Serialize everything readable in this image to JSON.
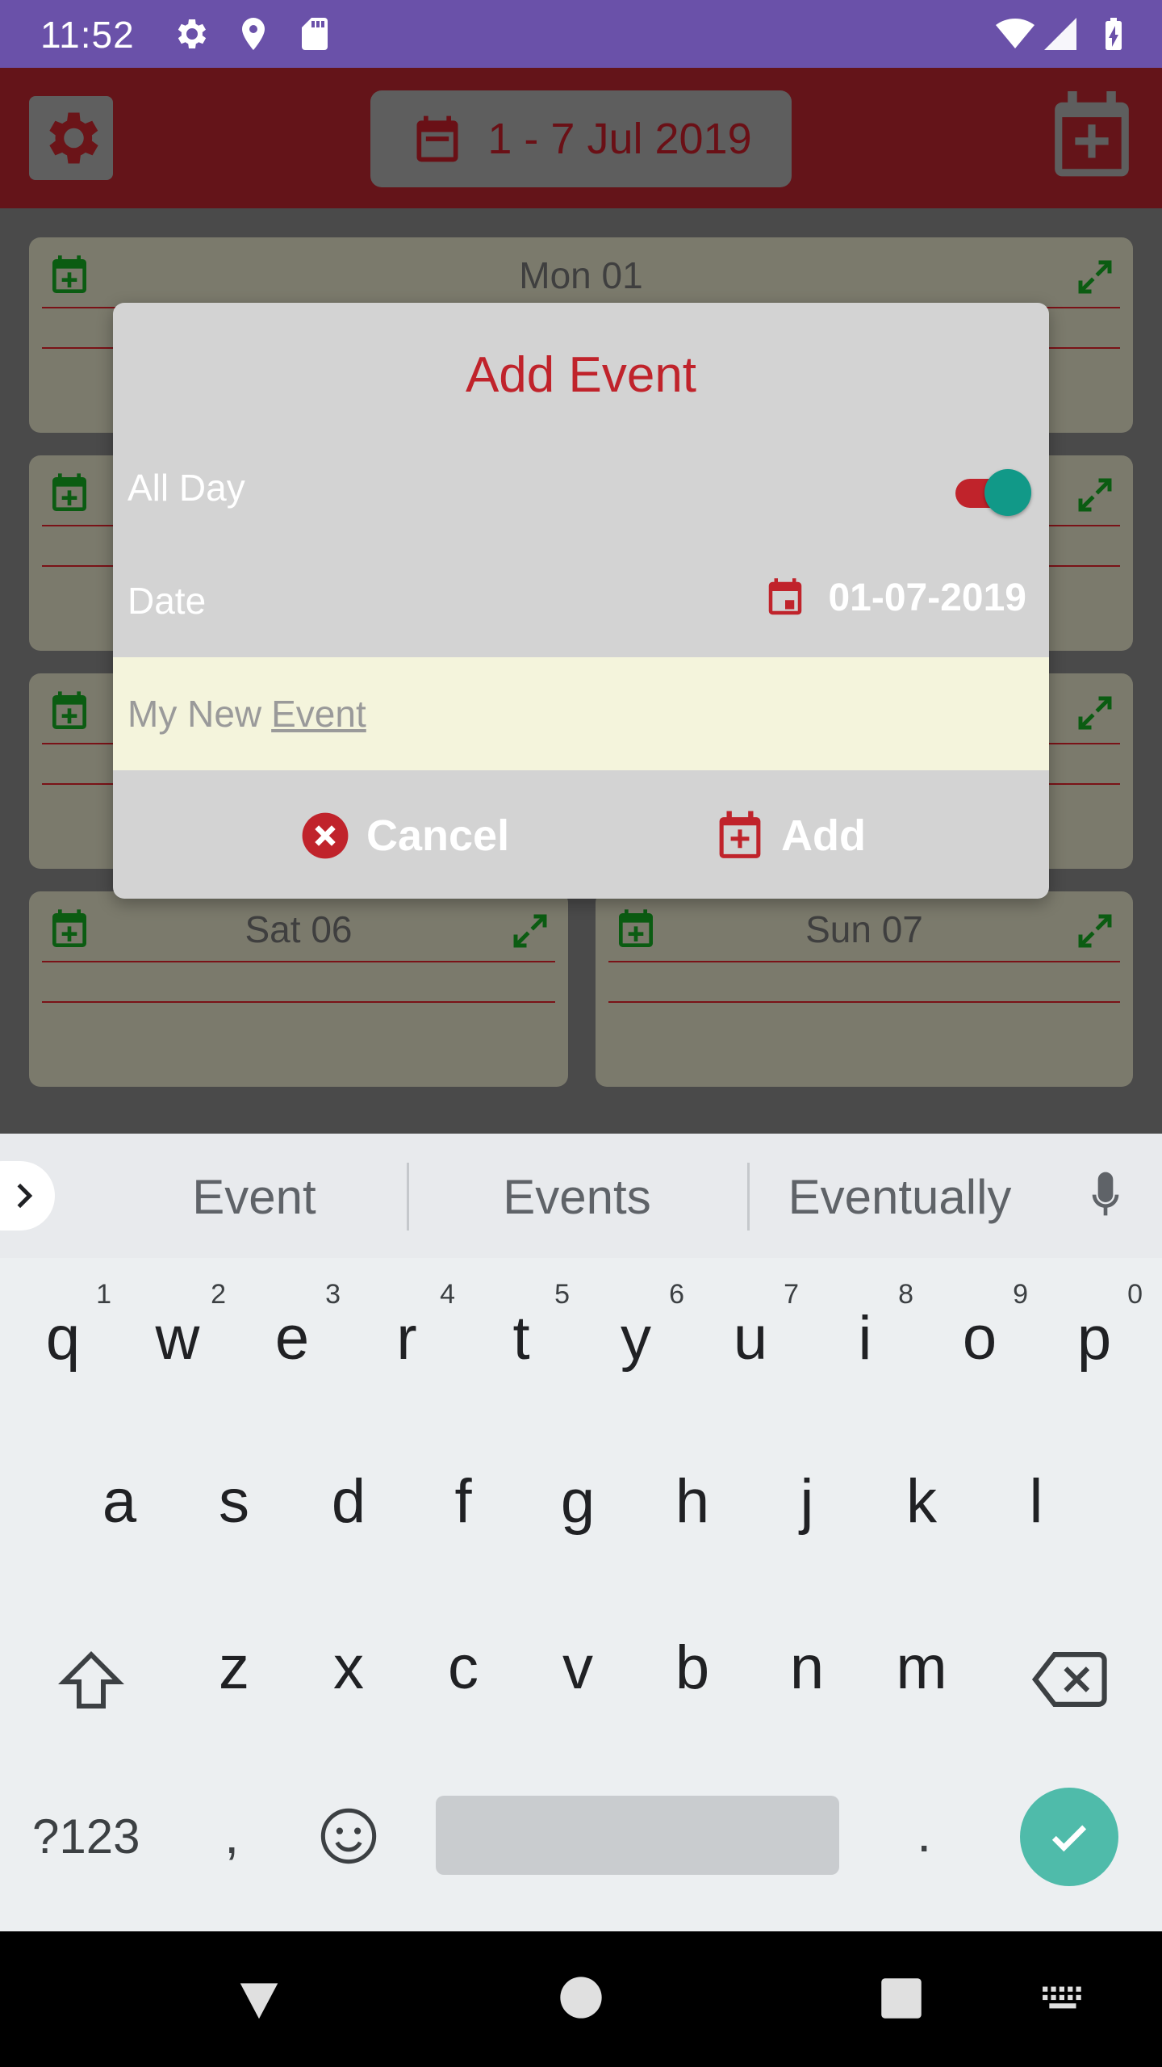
{
  "status_bar": {
    "time": "11:52",
    "icons": [
      "gear-icon",
      "location-icon",
      "sd-card-icon",
      "wifi-icon",
      "signal-icon",
      "battery-charging-icon"
    ],
    "background": "#6a51a9"
  },
  "app_bar": {
    "week_label": "1 - 7 Jul 2019",
    "background": "#641419"
  },
  "days": [
    {
      "label": "Mon 01"
    },
    {
      "label": ""
    },
    {
      "label": ""
    },
    {
      "label": ""
    },
    {
      "label": ""
    },
    {
      "label": ""
    },
    {
      "label": "Sat 06"
    },
    {
      "label": "Sun 07"
    }
  ],
  "dialog": {
    "title": "Add Event",
    "all_day_label": "All Day",
    "all_day_on": true,
    "date_label": "Date",
    "date_value": "01-07-2019",
    "name_value_prefix": "My New",
    "name_value_word": "Event",
    "cancel_label": "Cancel",
    "add_label": "Add",
    "accent": "#c0232b",
    "toggle_thumb": "#119988"
  },
  "keyboard": {
    "suggestions": [
      "Event",
      "Events",
      "Eventually"
    ],
    "row1": [
      {
        "k": "q",
        "n": "1"
      },
      {
        "k": "w",
        "n": "2"
      },
      {
        "k": "e",
        "n": "3"
      },
      {
        "k": "r",
        "n": "4"
      },
      {
        "k": "t",
        "n": "5"
      },
      {
        "k": "y",
        "n": "6"
      },
      {
        "k": "u",
        "n": "7"
      },
      {
        "k": "i",
        "n": "8"
      },
      {
        "k": "o",
        "n": "9"
      },
      {
        "k": "p",
        "n": "0"
      }
    ],
    "row2": [
      "a",
      "s",
      "d",
      "f",
      "g",
      "h",
      "j",
      "k",
      "l"
    ],
    "row3": [
      "z",
      "x",
      "c",
      "v",
      "b",
      "n",
      "m"
    ],
    "symbols_label": "?123",
    "comma": ",",
    "period": ".",
    "enter_color": "#4fbbaa"
  }
}
